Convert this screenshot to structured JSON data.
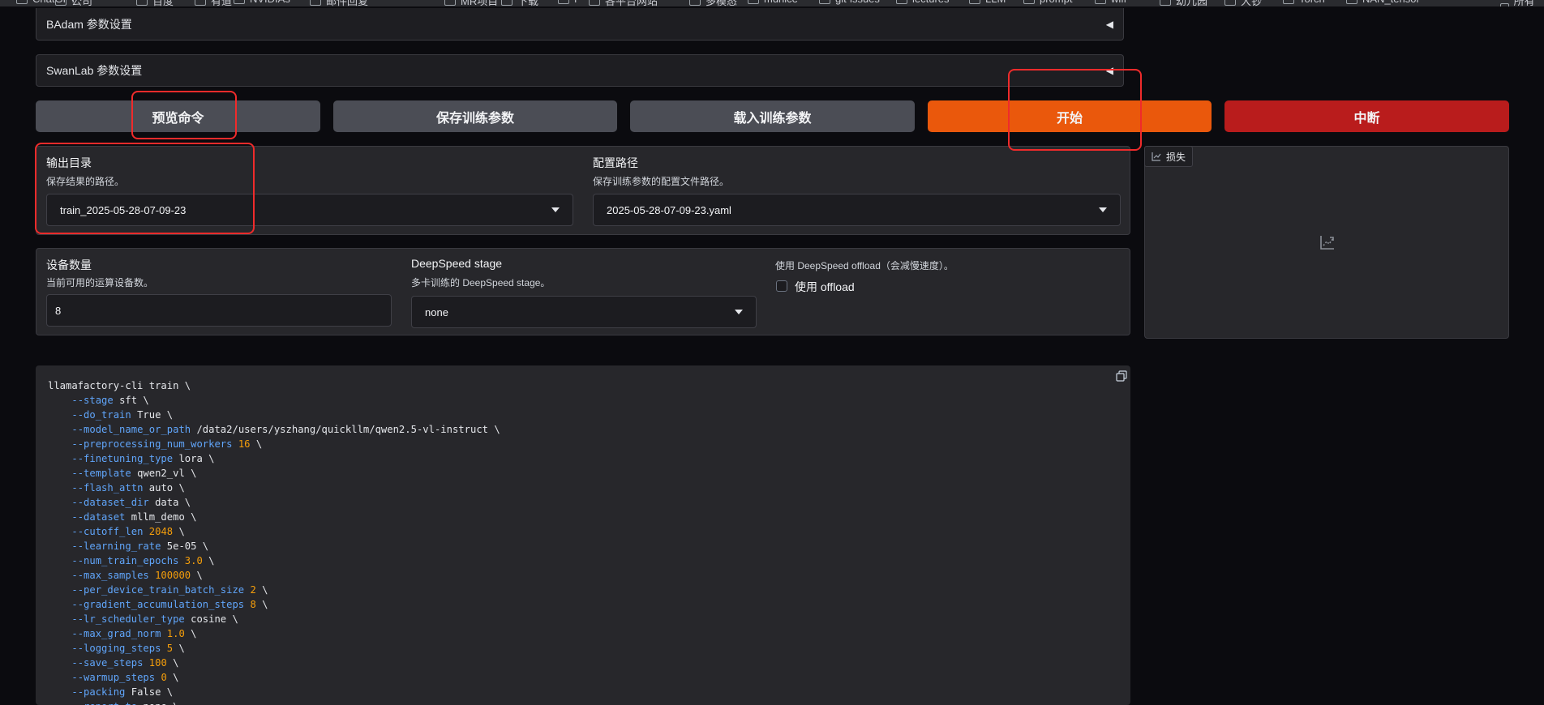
{
  "bookmarks": [
    "ChatGPT",
    "公司",
    "百度",
    "有道",
    "NVIDIAs",
    "邮件回复",
    "MR项目",
    "下载",
    "f",
    "各平台网站",
    "多模态",
    "mdnice",
    "git-issues",
    "lectures",
    "LLM",
    "prompt",
    "wifi",
    "幼儿园",
    "大钞",
    "Torch",
    "NAN_tensor",
    "所有书签"
  ],
  "sections": {
    "badam_title": "BAdam 参数设置",
    "swanlab_title": "SwanLab 参数设置",
    "caret": "◀"
  },
  "buttons": {
    "preview": "预览命令",
    "save_args": "保存训练参数",
    "load_args": "载入训练参数",
    "start": "开始",
    "abort": "中断"
  },
  "output": {
    "dir_label": "输出目录",
    "dir_help": "保存结果的路径。",
    "dir_value": "train_2025-05-28-07-09-23",
    "config_label": "配置路径",
    "config_help": "保存训练参数的配置文件路径。",
    "config_value": "2025-05-28-07-09-23.yaml"
  },
  "device": {
    "count_label": "设备数量",
    "count_help": "当前可用的运算设备数。",
    "count_value": "8",
    "ds_label": "DeepSpeed stage",
    "ds_help": "多卡训练的 DeepSpeed stage。",
    "ds_value": "none",
    "offload_help": "使用 DeepSpeed offload（会减慢速度）。",
    "offload_label": "使用 offload"
  },
  "chart": {
    "tab_label": "损失"
  },
  "command": {
    "head": "llamafactory-cli train \\",
    "args": [
      {
        "flag": "--stage",
        "value": "sft",
        "num": false
      },
      {
        "flag": "--do_train",
        "value": "True",
        "num": false
      },
      {
        "flag": "--model_name_or_path",
        "value": "/data2/users/yszhang/quickllm/qwen2.5-vl-instruct",
        "num": false
      },
      {
        "flag": "--preprocessing_num_workers",
        "value": "16",
        "num": true
      },
      {
        "flag": "--finetuning_type",
        "value": "lora",
        "num": false
      },
      {
        "flag": "--template",
        "value": "qwen2_vl",
        "num": false
      },
      {
        "flag": "--flash_attn",
        "value": "auto",
        "num": false
      },
      {
        "flag": "--dataset_dir",
        "value": "data",
        "num": false
      },
      {
        "flag": "--dataset",
        "value": "mllm_demo",
        "num": false
      },
      {
        "flag": "--cutoff_len",
        "value": "2048",
        "num": true
      },
      {
        "flag": "--learning_rate",
        "value": "5e-05",
        "num": false
      },
      {
        "flag": "--num_train_epochs",
        "value": "3.0",
        "num": true
      },
      {
        "flag": "--max_samples",
        "value": "100000",
        "num": true
      },
      {
        "flag": "--per_device_train_batch_size",
        "value": "2",
        "num": true
      },
      {
        "flag": "--gradient_accumulation_steps",
        "value": "8",
        "num": true
      },
      {
        "flag": "--lr_scheduler_type",
        "value": "cosine",
        "num": false
      },
      {
        "flag": "--max_grad_norm",
        "value": "1.0",
        "num": true
      },
      {
        "flag": "--logging_steps",
        "value": "5",
        "num": true
      },
      {
        "flag": "--save_steps",
        "value": "100",
        "num": true
      },
      {
        "flag": "--warmup_steps",
        "value": "0",
        "num": true
      },
      {
        "flag": "--packing",
        "value": "False",
        "num": false
      },
      {
        "flag": "--report_to",
        "value": "none",
        "num": false
      }
    ]
  },
  "colors": {
    "start": "#ea580c",
    "abort": "#b91c1c",
    "flag": "#60a5fa",
    "number": "#f59e0b",
    "annotation": "#ef2b2b"
  }
}
